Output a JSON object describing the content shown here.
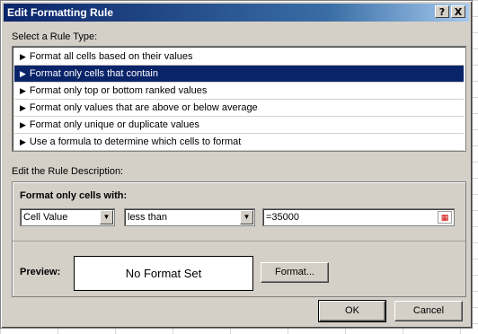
{
  "window": {
    "title": "Edit Formatting Rule",
    "help_button": "?",
    "close_button": "X"
  },
  "rule_type": {
    "label": "Select a Rule Type:",
    "items": [
      {
        "label": "Format all cells based on their values"
      },
      {
        "label": "Format only cells that contain",
        "selected": true
      },
      {
        "label": "Format only top or bottom ranked values"
      },
      {
        "label": "Format only values that are above or below average"
      },
      {
        "label": "Format only unique or duplicate values"
      },
      {
        "label": "Use a formula to determine which cells to format"
      }
    ]
  },
  "description": {
    "label": "Edit the Rule Description:",
    "title": "Format only cells with:",
    "condition_type": "Cell Value",
    "operator": "less than",
    "value": "=35000",
    "preview_label": "Preview:",
    "preview_text": "No Format Set",
    "format_button": "Format..."
  },
  "buttons": {
    "ok": "OK",
    "cancel": "Cancel"
  },
  "colors": {
    "title_bar": "#0a246a",
    "selection": "#0a246a",
    "dialog_bg": "#d4d0c8"
  },
  "icons": {
    "list_arrow": "▶",
    "dropdown": "▼"
  }
}
